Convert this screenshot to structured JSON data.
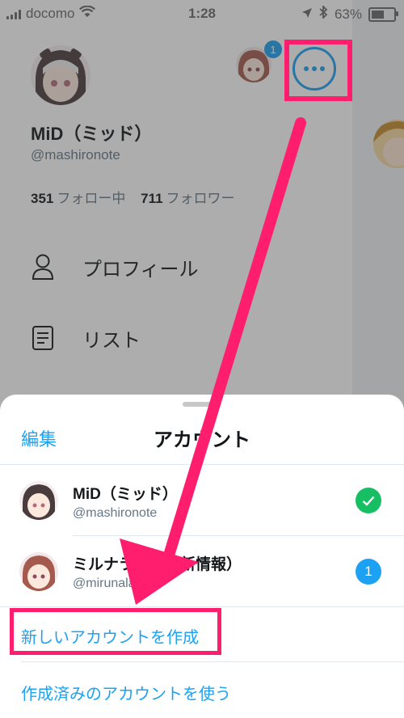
{
  "status_bar": {
    "carrier": "docomo",
    "time": "1:28",
    "battery": "63%",
    "battery_level": 0.63
  },
  "profile": {
    "name": "MiD（ミッド）",
    "handle": "@mashironote",
    "following_count": "351",
    "following_label": "フォロー中",
    "followers_count": "711",
    "followers_label": "フォロワー",
    "other_account_badge": "1"
  },
  "menu": [
    {
      "label": "プロフィール",
      "icon": "person-icon"
    },
    {
      "label": "リスト",
      "icon": "list-icon"
    }
  ],
  "sheet": {
    "edit_label": "編集",
    "title": "アカウント",
    "accounts": [
      {
        "name": "MiD（ミッド）",
        "handle": "@mashironote",
        "status": "active"
      },
      {
        "name": "ミルナラボ（最新情報）",
        "handle": "@mirunalabo",
        "badge": "1"
      }
    ],
    "create_label": "新しいアカウントを作成",
    "existing_label": "作成済みのアカウントを使う"
  },
  "colors": {
    "accent": "#1da1f2",
    "annotation": "#ff1e6e",
    "check": "#17bf63"
  }
}
